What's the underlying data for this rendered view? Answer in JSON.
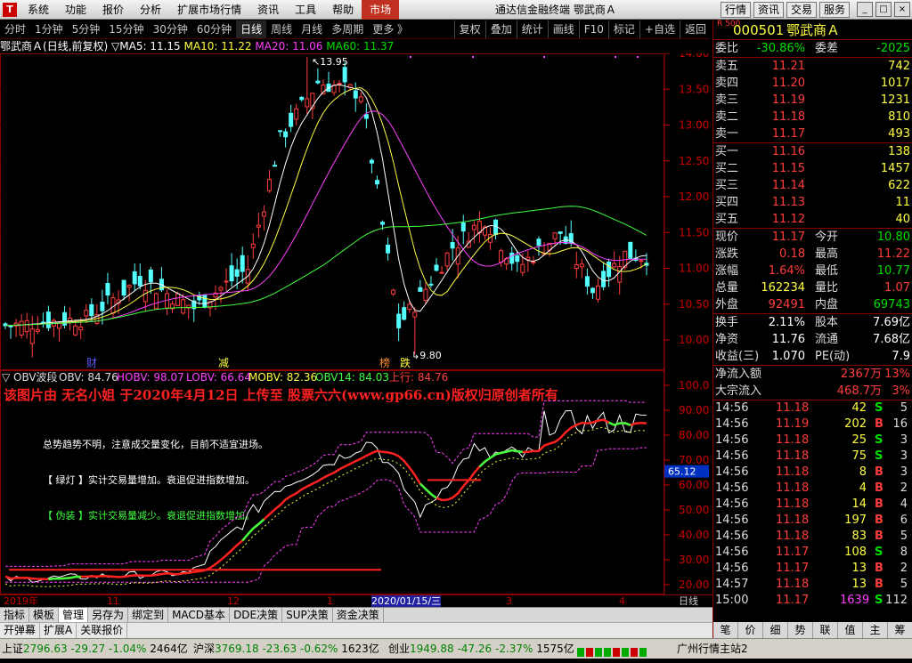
{
  "topbar": {
    "logo": "TDX",
    "menu": [
      "系统",
      "功能",
      "报价",
      "分析",
      "扩展市场行情",
      "资讯",
      "工具",
      "帮助",
      "市场"
    ],
    "title": "通达信金融终端  鄂武商Ａ",
    "buttons": [
      "行情",
      "资讯",
      "交易",
      "服务"
    ],
    "win": [
      "_",
      "□",
      "×"
    ]
  },
  "periods": [
    "分时",
    "1分钟",
    "5分钟",
    "15分钟",
    "30分钟",
    "60分钟",
    "日线",
    "周线",
    "月线",
    "多周期",
    "更多 》"
  ],
  "chart_buttons": [
    "复权",
    "叠加",
    "统计",
    "画线",
    "F10",
    "标记",
    "+自选",
    "返回"
  ],
  "ma_line": {
    "stock": "鄂武商Ａ",
    "period": "(日线,前复权)",
    "ma5_label": "MA5: 11.15",
    "ma10_label": "MA10: 11.22",
    "ma20_label": "MA20: 11.06",
    "ma60_label": "MA60: 11.37"
  },
  "price_axis": [
    "14.00",
    "13.50",
    "13.00",
    "12.50",
    "12.00",
    "11.50",
    "11.00",
    "10.50",
    "10.00"
  ],
  "annotations": {
    "high": "13.95",
    "low": "9.80",
    "markers": [
      "财",
      "减",
      "榜",
      "跌"
    ]
  },
  "obv_line": {
    "title": "▽ OBV波段",
    "obv": "OBV: 84.76",
    "hobv": "HOBV: 98.07",
    "lobv": "LOBV: 66.64",
    "mobv": "MOBV: 82.36",
    "obv14": "OBV14: 84.03",
    "trend": "上行: 84.76"
  },
  "watermark": "该图片由 无名小姐 于2020年4月12日 上传至 股票六六(www.gp66.cn)版权归原创者所有",
  "obv_notes": [
    "总势趋势不明，注意成交量变化，目前不适宜进场。",
    "【 绿灯 】实计交易量增加。衰退促进指数增加。",
    "【 伪装 】实计交易量减少。衰退促进指数增加。"
  ],
  "obv_axis": [
    "100.0",
    "90.00",
    "80.00",
    "70.00",
    "60.00",
    "50.00",
    "40.00",
    "30.00",
    "20.00"
  ],
  "obv_badge": "65.12",
  "xaxis": {
    "labels": [
      "2019年",
      "11",
      "12",
      "1",
      "2020/01/15/三",
      "3",
      "4"
    ],
    "right": "日线"
  },
  "bottom_tabs": [
    "指标",
    "模板",
    "管理",
    "另存为",
    "绑定到",
    "MACD基本",
    "DDE决策",
    "SUP决策",
    "资金决策"
  ],
  "bottom_tabs2": [
    "开弹幕",
    "扩展A",
    "关联报价"
  ],
  "quote": {
    "code": "000501",
    "name": "鄂武商Ａ",
    "badge": "R 500",
    "weibi_label": "委比",
    "weibi": "-30.86%",
    "weicha_label": "委差",
    "weicha": "-2025",
    "asks": [
      {
        "label": "卖五",
        "price": "11.21",
        "vol": "742"
      },
      {
        "label": "卖四",
        "price": "11.20",
        "vol": "1017"
      },
      {
        "label": "卖三",
        "price": "11.19",
        "vol": "1231"
      },
      {
        "label": "卖二",
        "price": "11.18",
        "vol": "810"
      },
      {
        "label": "卖一",
        "price": "11.17",
        "vol": "493"
      }
    ],
    "bids": [
      {
        "label": "买一",
        "price": "11.16",
        "vol": "138"
      },
      {
        "label": "买二",
        "price": "11.15",
        "vol": "1457"
      },
      {
        "label": "买三",
        "price": "11.14",
        "vol": "622"
      },
      {
        "label": "买四",
        "price": "11.13",
        "vol": "11"
      },
      {
        "label": "买五",
        "price": "11.12",
        "vol": "40"
      }
    ],
    "stats": [
      {
        "l1": "现价",
        "v1": "11.17",
        "c1": "red",
        "l2": "今开",
        "v2": "10.80",
        "c2": "green"
      },
      {
        "l1": "涨跌",
        "v1": "0.18",
        "c1": "red",
        "l2": "最高",
        "v2": "11.22",
        "c2": "red"
      },
      {
        "l1": "涨幅",
        "v1": "1.64%",
        "c1": "red",
        "l2": "最低",
        "v2": "10.77",
        "c2": "green"
      },
      {
        "l1": "总量",
        "v1": "162234",
        "c1": "yellow",
        "l2": "量比",
        "v2": "1.07",
        "c2": "red"
      },
      {
        "l1": "外盘",
        "v1": "92491",
        "c1": "red",
        "l2": "内盘",
        "v2": "69743",
        "c2": "green"
      }
    ],
    "stats2": [
      {
        "l1": "换手",
        "v1": "2.11%",
        "l2": "股本",
        "v2": "7.69亿"
      },
      {
        "l1": "净资",
        "v1": "11.76",
        "l2": "流通",
        "v2": "7.68亿"
      },
      {
        "l1": "收益(三)",
        "v1": "1.070",
        "l2": "PE(动)",
        "v2": "7.9"
      }
    ],
    "flows": [
      {
        "label": "净流入额",
        "value": "2367万",
        "pct": "13%"
      },
      {
        "label": "大宗流入",
        "value": "468.7万",
        "pct": "3%"
      }
    ],
    "ticks": [
      {
        "t": "14:56",
        "p": "11.18",
        "v": "42",
        "bs": "S",
        "n": "5"
      },
      {
        "t": "14:56",
        "p": "11.19",
        "v": "202",
        "bs": "B",
        "n": "16"
      },
      {
        "t": "14:56",
        "p": "11.18",
        "v": "25",
        "bs": "S",
        "n": "3"
      },
      {
        "t": "14:56",
        "p": "11.18",
        "v": "75",
        "bs": "S",
        "n": "3"
      },
      {
        "t": "14:56",
        "p": "11.18",
        "v": "8",
        "bs": "B",
        "n": "3"
      },
      {
        "t": "14:56",
        "p": "11.18",
        "v": "4",
        "bs": "B",
        "n": "2"
      },
      {
        "t": "14:56",
        "p": "11.18",
        "v": "14",
        "bs": "B",
        "n": "4"
      },
      {
        "t": "14:56",
        "p": "11.18",
        "v": "197",
        "bs": "B",
        "n": "6"
      },
      {
        "t": "14:56",
        "p": "11.18",
        "v": "83",
        "bs": "B",
        "n": "5"
      },
      {
        "t": "14:56",
        "p": "11.17",
        "v": "108",
        "bs": "S",
        "n": "8"
      },
      {
        "t": "14:56",
        "p": "11.17",
        "v": "13",
        "bs": "B",
        "n": "2"
      },
      {
        "t": "14:57",
        "p": "11.18",
        "v": "13",
        "bs": "B",
        "n": "5"
      },
      {
        "t": "15:00",
        "p": "11.17",
        "v": "1639",
        "bs": "S",
        "n": "112"
      }
    ],
    "tabs": [
      "笔",
      "价",
      "细",
      "势",
      "联",
      "值",
      "主",
      "筹"
    ]
  },
  "status": {
    "sh": {
      "label": "上证",
      "value": "2796.63",
      "chg": "-29.27",
      "pct": "-1.04%",
      "amt": "2464亿"
    },
    "hs": {
      "label": "沪深",
      "value": "3769.18",
      "chg": "-23.63",
      "pct": "-0.62%",
      "amt": "1623亿"
    },
    "cy": {
      "label": "创业",
      "value": "1949.88",
      "chg": "-47.26",
      "pct": "-2.37%",
      "amt": "1575亿"
    },
    "server": "广州行情主站2"
  }
}
